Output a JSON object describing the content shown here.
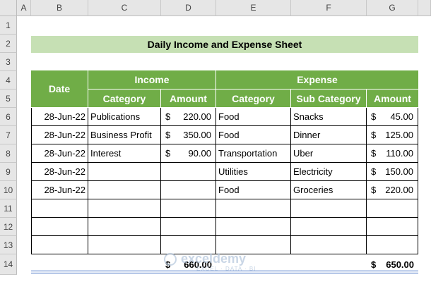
{
  "sheet": {
    "columns": [
      "A",
      "B",
      "C",
      "D",
      "E",
      "F",
      "G"
    ],
    "rows": [
      "1",
      "2",
      "3",
      "4",
      "5",
      "6",
      "7",
      "8",
      "9",
      "10",
      "11",
      "12",
      "13",
      "14"
    ],
    "title": "Daily Income and Expense Sheet",
    "headers": {
      "date": "Date",
      "income": "Income",
      "expense": "Expense",
      "income_category": "Category",
      "income_amount": "Amount",
      "expense_category": "Category",
      "expense_subcategory": "Sub Category",
      "expense_amount": "Amount"
    },
    "currency": "$",
    "records": [
      {
        "date": "28-Jun-22",
        "income_category": "Publications",
        "income_amount": "220.00",
        "expense_category": "Food",
        "expense_subcategory": "Snacks",
        "expense_amount": "45.00"
      },
      {
        "date": "28-Jun-22",
        "income_category": "Business Profit",
        "income_amount": "350.00",
        "expense_category": "Food",
        "expense_subcategory": "Dinner",
        "expense_amount": "125.00"
      },
      {
        "date": "28-Jun-22",
        "income_category": "Interest",
        "income_amount": "90.00",
        "expense_category": "Transportation",
        "expense_subcategory": "Uber",
        "expense_amount": "110.00"
      },
      {
        "date": "28-Jun-22",
        "income_category": "",
        "income_amount": "",
        "expense_category": "Utilities",
        "expense_subcategory": "Electricity",
        "expense_amount": "150.00"
      },
      {
        "date": "28-Jun-22",
        "income_category": "",
        "income_amount": "",
        "expense_category": "Food",
        "expense_subcategory": "Groceries",
        "expense_amount": "220.00"
      },
      {
        "date": "",
        "income_category": "",
        "income_amount": "",
        "expense_category": "",
        "expense_subcategory": "",
        "expense_amount": ""
      },
      {
        "date": "",
        "income_category": "",
        "income_amount": "",
        "expense_category": "",
        "expense_subcategory": "",
        "expense_amount": ""
      },
      {
        "date": "",
        "income_category": "",
        "income_amount": "",
        "expense_category": "",
        "expense_subcategory": "",
        "expense_amount": ""
      }
    ],
    "totals": {
      "income": "660.00",
      "expense": "650.00"
    }
  },
  "watermark": {
    "name": "exceldemy",
    "tagline": "EXCEL · DATA · BI"
  },
  "colors": {
    "green_header": "#70ad47",
    "light_green_title": "#c6e0b4",
    "grid_header": "#e6e6e6",
    "double_line": "#4472c4"
  }
}
